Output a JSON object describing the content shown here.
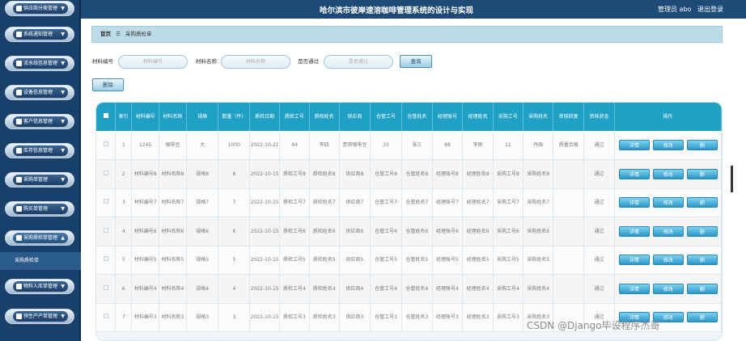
{
  "header": {
    "title": "哈尔滨市彼岸速溶咖啡管理系统的设计与实现",
    "role": "管理员 abo",
    "logout": "退出登录"
  },
  "sidebar": {
    "items": [
      {
        "label": "供应商分类管理",
        "icon": "grid-icon"
      },
      {
        "label": "系统通知管理",
        "icon": "user-icon"
      },
      {
        "label": "流水线信息管理",
        "icon": "cup-icon"
      },
      {
        "label": "设备信息管理",
        "icon": "flag-icon"
      },
      {
        "label": "客户信息管理",
        "icon": "grid-icon"
      },
      {
        "label": "库存信息管理",
        "icon": "list-icon"
      },
      {
        "label": "采购单管理",
        "icon": "grid-icon"
      },
      {
        "label": "购买单管理",
        "icon": "grid-icon"
      },
      {
        "label": "采购质检单管理",
        "icon": "grid-icon"
      },
      {
        "label": "物料入库单管理",
        "icon": "pin-icon"
      },
      {
        "label": "预生产产单管理",
        "icon": "chart-icon"
      }
    ],
    "active_sub": "采购质检单"
  },
  "breadcrumb": {
    "home": "首页",
    "sep": "☰",
    "current": "采购质检单"
  },
  "search": {
    "material_no_label": "材料编号",
    "material_no_placeholder": "材料编号",
    "material_name_label": "材料名称",
    "material_name_placeholder": "材料名称",
    "passed_label": "是否通过",
    "passed_placeholder": "是否通过",
    "query_button": "查询",
    "delete_button": "删除"
  },
  "table": {
    "headers": [
      "索引",
      "材料编号",
      "材料名称",
      "规格",
      "数量（件）",
      "质检日期",
      "质检工号",
      "质检姓名",
      "供应商",
      "仓管工号",
      "仓管姓名",
      "经理账号",
      "经理姓名",
      "采购工号",
      "采购姓名",
      "审核回复",
      "审核状态",
      "操作"
    ],
    "rows": [
      [
        "1",
        "1245",
        "咖啡豆",
        "大",
        "1000",
        "2022-10-21",
        "44",
        "李四",
        "贵宾咖啡豆",
        "33",
        "张三",
        "88",
        "李刚",
        "11",
        "丹政",
        "质量合格",
        "通过"
      ],
      [
        "2",
        "材料编号8",
        "材料名称8",
        "规格8",
        "8",
        "2022-10-15",
        "质检工号8",
        "质检姓名8",
        "供应商8",
        "仓管工号8",
        "仓管姓名8",
        "经理账号8",
        "经理姓名8",
        "采购工号8",
        "采购姓名8",
        "",
        "通过"
      ],
      [
        "3",
        "材料编号7",
        "材料名称7",
        "规格7",
        "7",
        "2022-10-15",
        "质检工号7",
        "质检姓名7",
        "供应商7",
        "仓管工号7",
        "仓管姓名7",
        "经理账号7",
        "经理姓名7",
        "采购工号7",
        "采购姓名7",
        "",
        "通过"
      ],
      [
        "4",
        "材料编号6",
        "材料名称6",
        "规格6",
        "6",
        "2022-10-15",
        "质检工号6",
        "质检姓名6",
        "供应商6",
        "仓管工号6",
        "仓管姓名6",
        "经理账号6",
        "经理姓名6",
        "采购工号6",
        "采购姓名6",
        "",
        "通过"
      ],
      [
        "5",
        "材料编号5",
        "材料名称5",
        "规格5",
        "5",
        "2022-10-15",
        "质检工号5",
        "质检姓名5",
        "供应商5",
        "仓管工号5",
        "仓管姓名5",
        "经理账号5",
        "经理姓名5",
        "采购工号5",
        "采购姓名5",
        "",
        "通过"
      ],
      [
        "6",
        "材料编号4",
        "材料名称4",
        "规格4",
        "4",
        "2022-10-15",
        "质检工号4",
        "质检姓名4",
        "供应商4",
        "仓管工号4",
        "仓管姓名4",
        "经理账号4",
        "经理姓名4",
        "采购工号4",
        "采购姓名4",
        "",
        "通过"
      ],
      [
        "7",
        "材料编号3",
        "材料名称3",
        "规格3",
        "3",
        "2022-10-15",
        "质检工号3",
        "质检姓名3",
        "供应商3",
        "仓管工号3",
        "仓管姓名3",
        "经理账号3",
        "经理姓名3",
        "采购工号3",
        "采购姓名3",
        "",
        "通过"
      ]
    ],
    "actions": [
      "详情",
      "修改",
      "删"
    ]
  },
  "watermark": "CSDN @Django毕设程序杰哥"
}
